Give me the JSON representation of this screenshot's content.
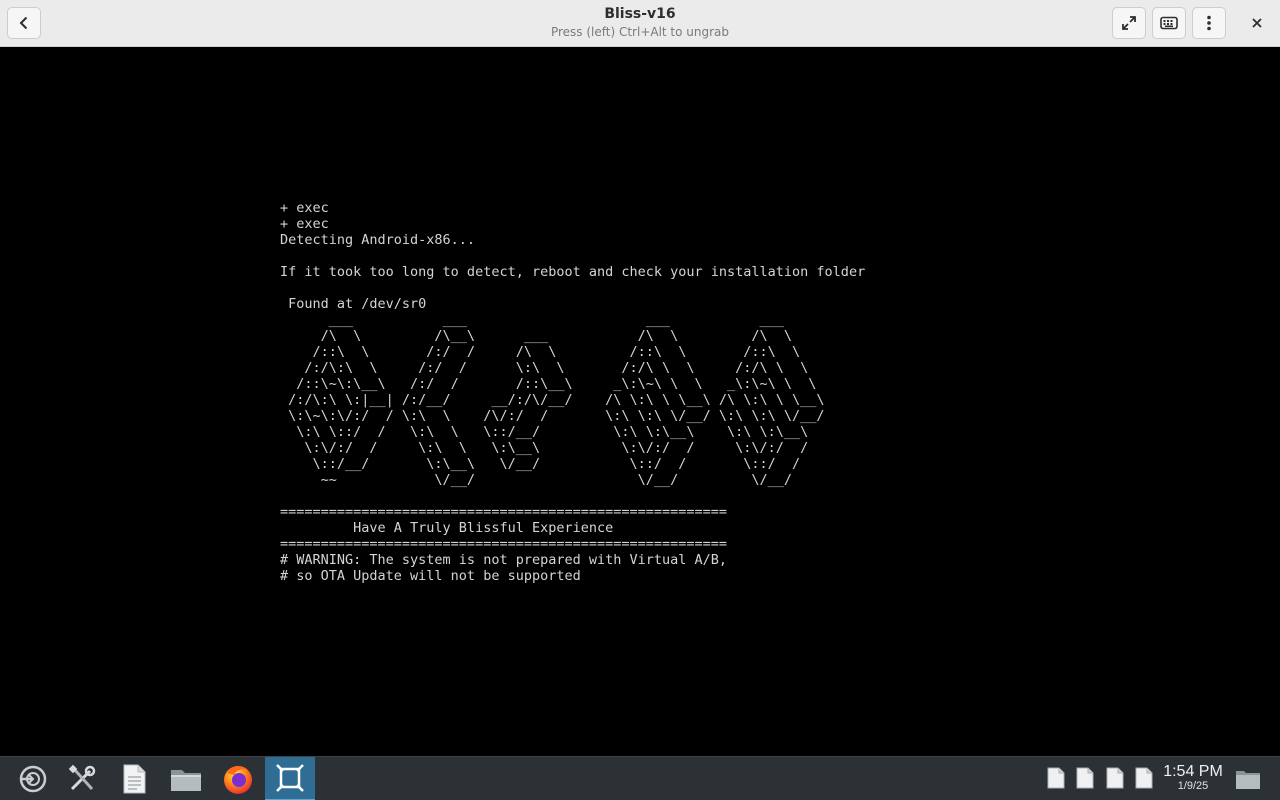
{
  "window": {
    "title": "Bliss-v16",
    "subtitle": "Press (left) Ctrl+Alt to ungrab"
  },
  "header_buttons": {
    "back": "back-icon",
    "fullscreen": "fullscreen-icon",
    "keyboard": "keyboard-icon",
    "menu": "kebab-menu-icon",
    "close": "close-icon"
  },
  "console": {
    "text": "+ exec\n+ exec\nDetecting Android-x86...\n\nIf it took too long to detect, reboot and check your installation folder\n\n Found at /dev/sr0\n      ___           ___                      ___           ___\n     /\\  \\         /\\__\\      ___           /\\  \\         /\\  \\\n    /::\\  \\       /:/  /     /\\  \\         /::\\  \\       /::\\  \\\n   /:/\\:\\  \\     /:/  /      \\:\\  \\       /:/\\ \\  \\     /:/\\ \\  \\\n  /::\\~\\:\\__\\   /:/  /       /::\\__\\     _\\:\\~\\ \\  \\   _\\:\\~\\ \\  \\\n /:/\\:\\ \\:|__| /:/__/     __/:/\\/__/    /\\ \\:\\ \\ \\__\\ /\\ \\:\\ \\ \\__\\\n \\:\\~\\:\\/:/  / \\:\\  \\    /\\/:/  /       \\:\\ \\:\\ \\/__/ \\:\\ \\:\\ \\/__/\n  \\:\\ \\::/  /   \\:\\  \\   \\::/__/         \\:\\ \\:\\__\\    \\:\\ \\:\\__\\\n   \\:\\/:/  /     \\:\\  \\   \\:\\__\\          \\:\\/:/  /     \\:\\/:/  /\n    \\::/__/       \\:\\__\\   \\/__/           \\::/  /       \\::/  /\n     ~~            \\/__/                    \\/__/         \\/__/\n\n=======================================================\n         Have A Truly Blissful Experience\n=======================================================\n# WARNING: The system is not prepared with Virtual A/B,\n# so OTA Update will not be supported"
  },
  "taskbar": {
    "items": [
      "app-menu-icon",
      "settings-tools-icon",
      "text-editor-icon",
      "file-manager-icon",
      "firefox-icon",
      "virtual-machine-icon"
    ],
    "active": "virtual-machine-icon",
    "tray": [
      "document-icon",
      "document-icon",
      "document-icon",
      "document-icon"
    ],
    "clock_time": "1:54 PM",
    "clock_date": "1/9/25",
    "show_desktop": "folder-icon"
  }
}
